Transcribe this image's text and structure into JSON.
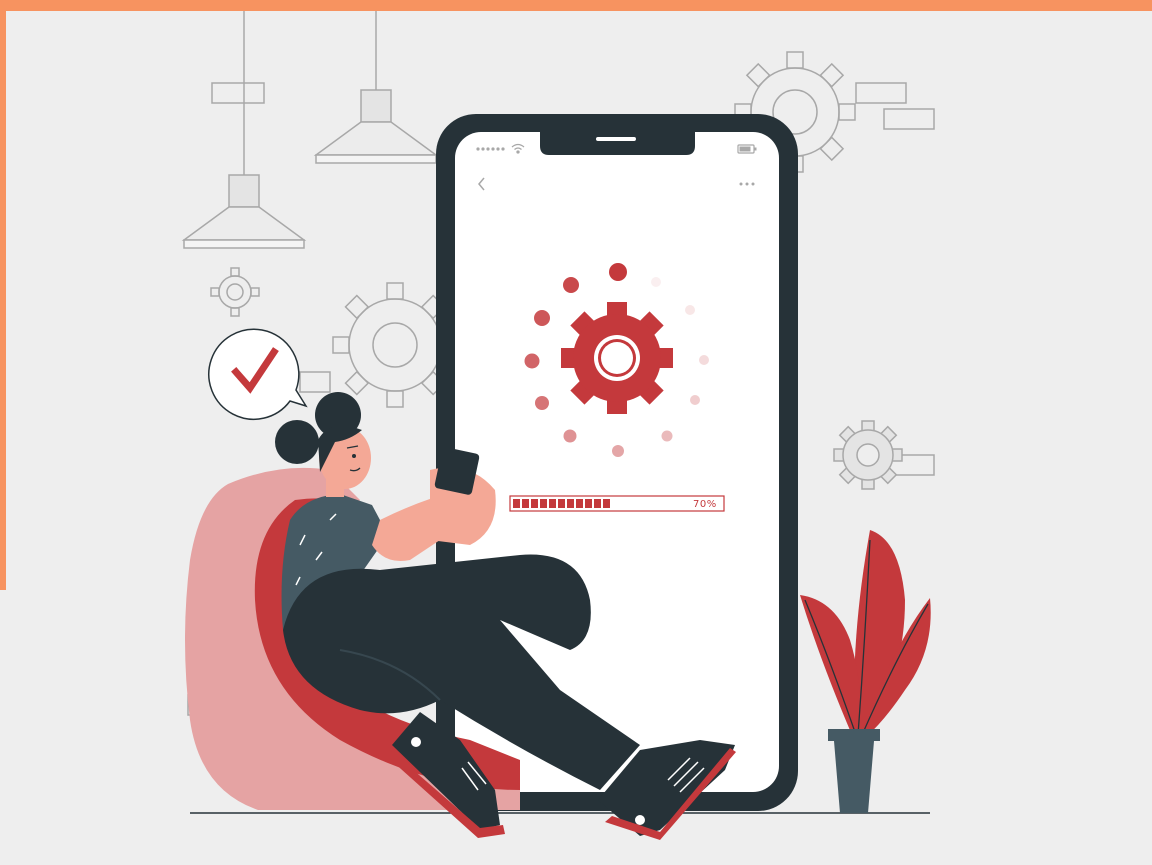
{
  "colors": {
    "frame_accent": "#f79360",
    "background": "#eeeeee",
    "phone_body": "#263238",
    "phone_screen": "#ffffff",
    "primary_red": "#c4393c",
    "pink": "#e5a3a3",
    "skin": "#f4a896",
    "outline_grey": "#a8a8a8"
  },
  "phone": {
    "status_icons": [
      "signal-dots-icon",
      "wifi-icon",
      "battery-icon"
    ],
    "top_icons": [
      "back-chevron-icon",
      "more-dots-icon"
    ]
  },
  "progress": {
    "value": 0.7,
    "label": "70%",
    "segments_total": 16,
    "segments_filled": 11
  },
  "speech_bubble": {
    "icon": "checkmark-icon"
  }
}
